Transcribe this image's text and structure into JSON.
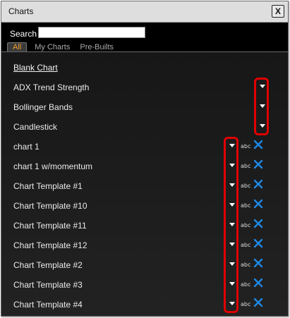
{
  "window": {
    "title": "Charts",
    "close_label": "X"
  },
  "search": {
    "label": "Search",
    "value": "",
    "placeholder": ""
  },
  "tabs": [
    {
      "label": "All",
      "active": true
    },
    {
      "label": "My Charts",
      "active": false
    },
    {
      "label": "Pre-Builts",
      "active": false
    }
  ],
  "list": {
    "items": [
      {
        "label": "Blank Chart",
        "type": "link"
      },
      {
        "label": "ADX Trend Strength",
        "type": "prebuilt"
      },
      {
        "label": "Bollinger Bands",
        "type": "prebuilt"
      },
      {
        "label": "Candlestick",
        "type": "prebuilt"
      },
      {
        "label": "chart 1",
        "type": "user"
      },
      {
        "label": "chart 1 w/momentum",
        "type": "user"
      },
      {
        "label": "Chart Template #1",
        "type": "user"
      },
      {
        "label": "Chart Template #10",
        "type": "user"
      },
      {
        "label": "Chart Template #11",
        "type": "user"
      },
      {
        "label": "Chart Template #12",
        "type": "user"
      },
      {
        "label": "Chart Template #2",
        "type": "user"
      },
      {
        "label": "Chart Template #3",
        "type": "user"
      },
      {
        "label": "Chart Template #4",
        "type": "user"
      }
    ],
    "rename_label": "abc",
    "icons": {
      "dropdown": "caret-down-icon",
      "rename": "rename-icon",
      "delete": "delete-x-icon"
    }
  },
  "colors": {
    "accent_tab": "#f0a02a",
    "delete_icon": "#1e88e5",
    "highlight": "#e00000"
  }
}
